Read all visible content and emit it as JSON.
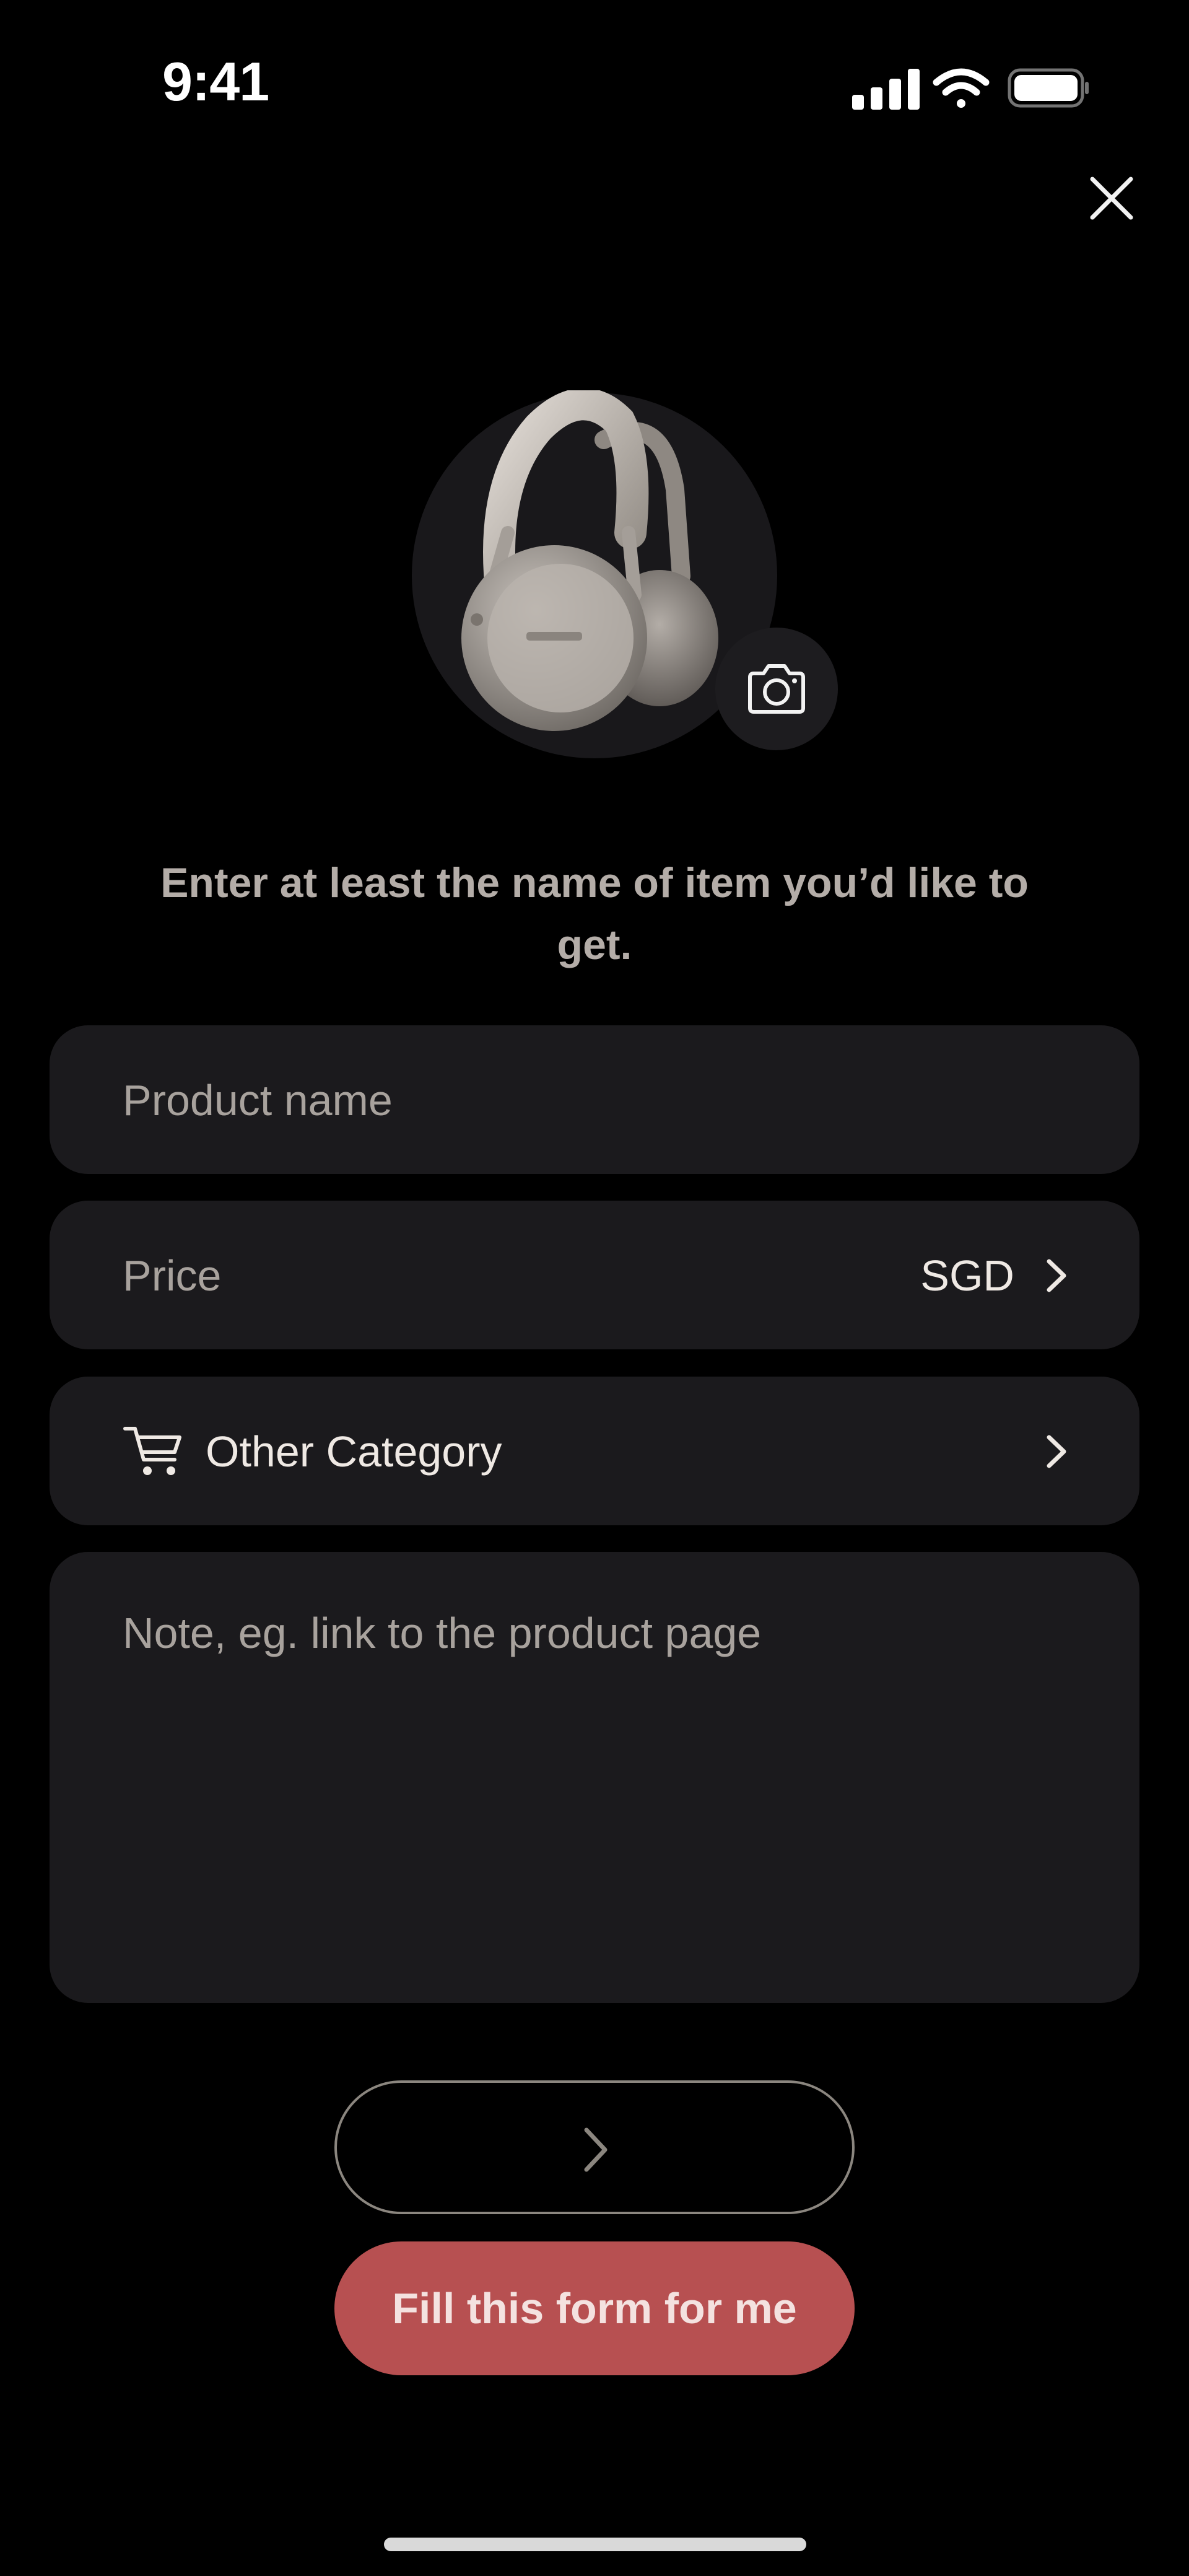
{
  "status_bar": {
    "time": "9:41",
    "icons": [
      "cellular-signal-icon",
      "wifi-icon",
      "battery-icon"
    ]
  },
  "close_icon": "close-icon",
  "product_image": {
    "alt": "headphones-image",
    "camera_icon": "camera-icon"
  },
  "instruction": "Enter at least the name of item you’d like to get.",
  "form": {
    "product_name": {
      "placeholder": "Product name",
      "value": ""
    },
    "price": {
      "placeholder": "Price",
      "currency": "SGD"
    },
    "category": {
      "icon": "cart-icon",
      "value": "Other Category"
    },
    "note": {
      "placeholder": "Note, eg. link to the product page",
      "value": ""
    }
  },
  "buttons": {
    "next_icon": "chevron-right-icon",
    "fill_form_label": "Fill this form for me"
  },
  "colors": {
    "background": "#000000",
    "field_background": "#1b1a1d",
    "accent": "#b75051",
    "placeholder": "#a8a29d",
    "instruction": "#b4ada8"
  }
}
